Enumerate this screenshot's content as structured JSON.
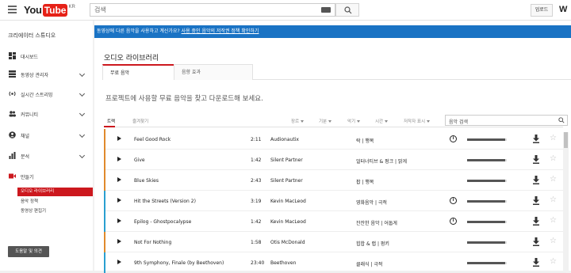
{
  "header": {
    "logo_you": "You",
    "logo_tube": "Tube",
    "logo_region": "KR",
    "search_placeholder": "검색",
    "upload_label": "업로드",
    "account_initial": "W"
  },
  "sidebar": {
    "title": "크리에이터 스튜디오",
    "items": [
      {
        "label": "대시보드",
        "icon": "dashboard-icon"
      },
      {
        "label": "동영상 관리자",
        "icon": "video-manager-icon"
      },
      {
        "label": "실시간 스트리밍",
        "icon": "live-icon"
      },
      {
        "label": "커뮤니티",
        "icon": "community-icon"
      },
      {
        "label": "채널",
        "icon": "channel-icon"
      },
      {
        "label": "분석",
        "icon": "analytics-icon"
      },
      {
        "label": "만들기",
        "icon": "create-icon"
      }
    ],
    "sub_items": [
      {
        "label": "오디오 라이브러리",
        "active": true
      },
      {
        "label": "음악 정책",
        "active": false
      },
      {
        "label": "동영상 편집기",
        "active": false
      }
    ],
    "help_label": "도움말 및 의견"
  },
  "banner": {
    "text": "동영상에 다른 음악을 사용하고 계신가요? ",
    "link": "사용 중인 음악의 저작권 정책 확인하기"
  },
  "main": {
    "title": "오디오 라이브러리",
    "tabs": [
      {
        "label": "무료 음악",
        "active": true
      },
      {
        "label": "음향 효과",
        "active": false
      }
    ],
    "intro": "프로젝트에 사용할 무료 음악을 찾고 다운로드해 보세요."
  },
  "filters": {
    "items": [
      {
        "label": "트랙",
        "active": true,
        "caret": false
      },
      {
        "label": "즐겨찾기",
        "active": false,
        "caret": false
      },
      {
        "label": "장르",
        "active": false,
        "caret": true
      },
      {
        "label": "기분",
        "active": false,
        "caret": true
      },
      {
        "label": "악기",
        "active": false,
        "caret": true
      },
      {
        "label": "시간",
        "active": false,
        "caret": true
      },
      {
        "label": "저작자 표시",
        "active": false,
        "caret": true
      }
    ],
    "search_placeholder": "음악 검색"
  },
  "tracks": [
    {
      "title": "Feel Good Rock",
      "duration": "2:11",
      "artist": "Audionautix",
      "genre": "락 | 행복",
      "attribution": true,
      "popularity": 0.95,
      "color": "#e08a2c"
    },
    {
      "title": "Give",
      "duration": "1:42",
      "artist": "Silent Partner",
      "genre": "얼터너티브 & 펑크 | 밝게",
      "attribution": false,
      "popularity": 0.95,
      "color": "#e08a2c"
    },
    {
      "title": "Blue Skies",
      "duration": "2:43",
      "artist": "Silent Partner",
      "genre": "팝 | 행복",
      "attribution": false,
      "popularity": 0.95,
      "color": "#e08a2c"
    },
    {
      "title": "Hit the Streets (Version 2)",
      "duration": "3:19",
      "artist": "Kevin MacLeod",
      "genre": "영화음악 | 극적",
      "attribution": true,
      "popularity": 0.95,
      "color": "#2a9fd0"
    },
    {
      "title": "Epilog - Ghostpocalypse",
      "duration": "1:42",
      "artist": "Kevin MacLeod",
      "genre": "잔잔한 음악 | 어둡게",
      "attribution": true,
      "popularity": 0.95,
      "color": "#2a9fd0"
    },
    {
      "title": "Not For Nothing",
      "duration": "1:58",
      "artist": "Otis McDonald",
      "genre": "힙합 & 랩 | 펑키",
      "attribution": false,
      "popularity": 0.95,
      "color": "#e08a2c"
    },
    {
      "title": "9th Symphony, Finale (by Beethoven)",
      "duration": "23:40",
      "artist": "Beethoven",
      "genre": "클래식 | 극적",
      "attribution": false,
      "popularity": 0.95,
      "color": "#2a9fd0"
    }
  ],
  "colors": {
    "accent": "#cc181e",
    "banner": "#1a73c4"
  }
}
